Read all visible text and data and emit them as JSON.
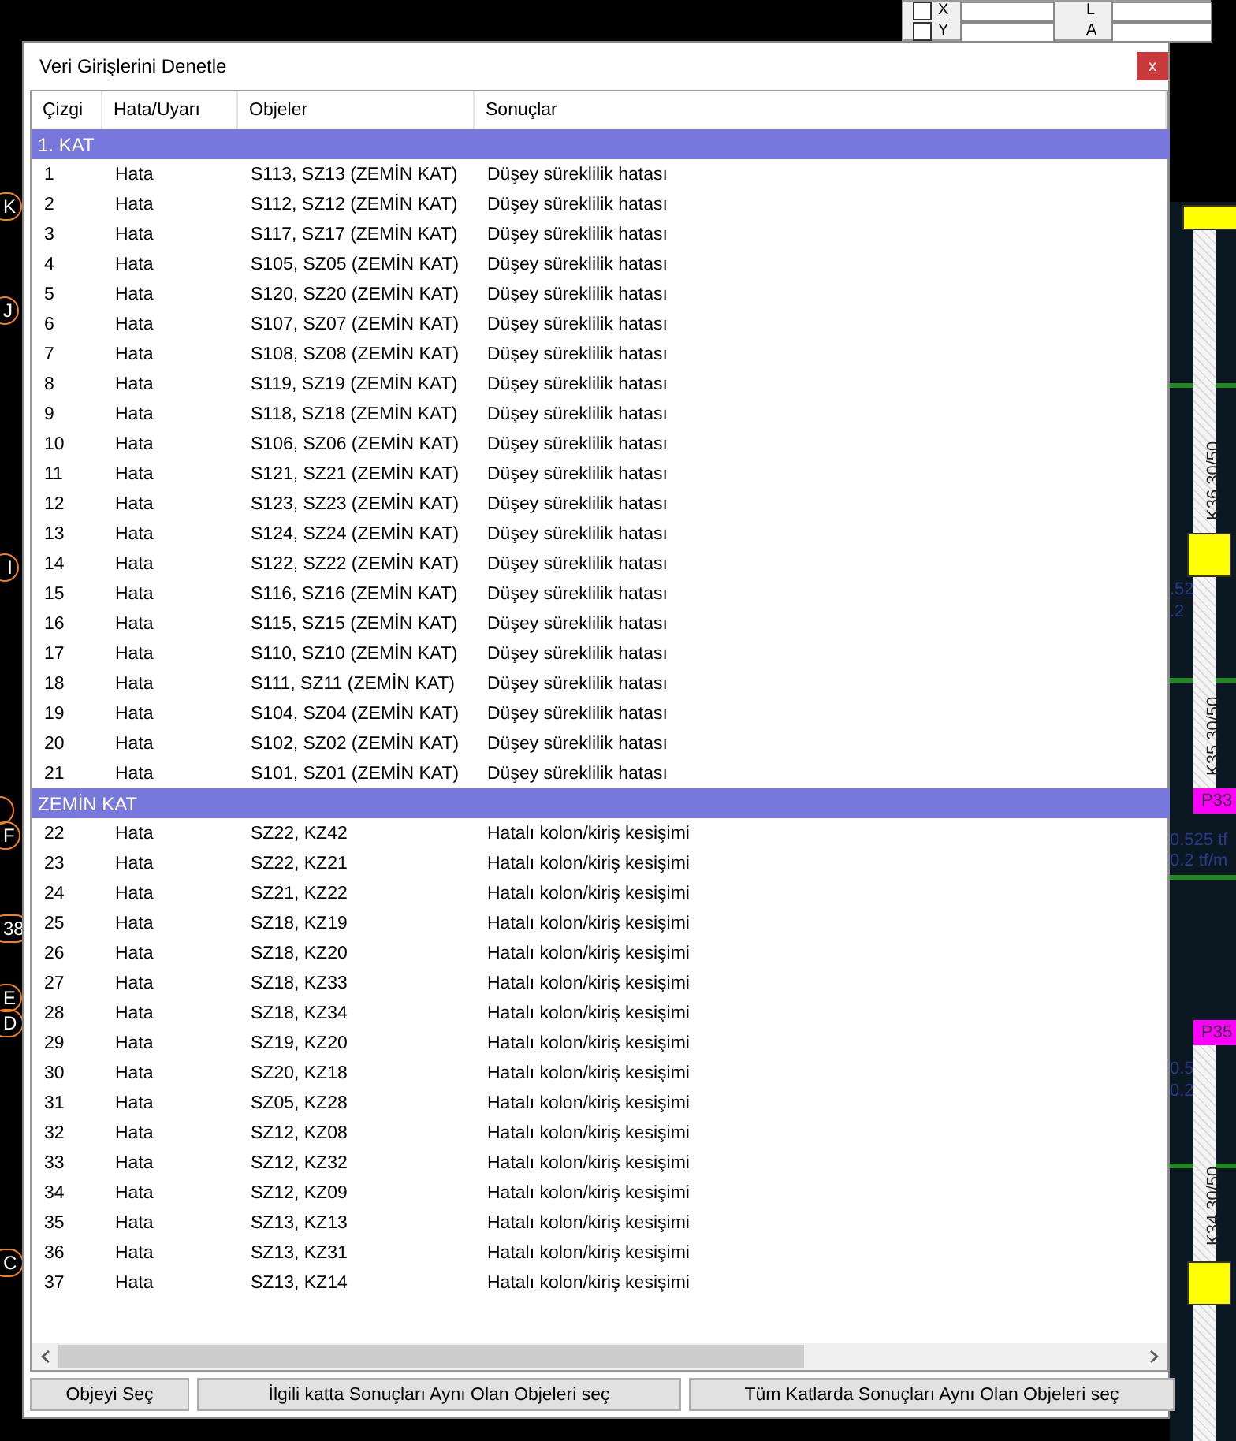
{
  "cad_panel": {
    "checks": [
      {
        "label": "X",
        "checked": false
      },
      {
        "label": "Y",
        "checked": false
      }
    ],
    "field_labels": [
      "L",
      "A"
    ]
  },
  "cad_axes": [
    {
      "label": "K"
    },
    {
      "label": "J"
    },
    {
      "label": "I"
    },
    {
      "label": "F"
    },
    {
      "label": "38"
    },
    {
      "label": "E"
    },
    {
      "label": "D"
    },
    {
      "label": "C"
    }
  ],
  "cad_beams": [
    "K36 30/50",
    "K35 30/50",
    "K34 30/50"
  ],
  "cad_columns": [
    "P33",
    "P35"
  ],
  "cad_loads": [
    ".52",
    ".2",
    "0.525 tf",
    "0.2 tf/m",
    "0.5",
    "0.2"
  ],
  "window": {
    "title": "Veri Girişlerini Denetle",
    "close": "x"
  },
  "table": {
    "columns": [
      "Çizgi",
      "Hata/Uyarı",
      "Objeler",
      "Sonuçlar"
    ],
    "groups": [
      {
        "title": "1. KAT",
        "rows": [
          {
            "line": "1",
            "type": "Hata",
            "objects": "S113, SZ13 (ZEMİN KAT)",
            "result": "Düşey süreklilik hatası"
          },
          {
            "line": "2",
            "type": "Hata",
            "objects": "S112, SZ12 (ZEMİN KAT)",
            "result": "Düşey süreklilik hatası"
          },
          {
            "line": "3",
            "type": "Hata",
            "objects": "S117, SZ17 (ZEMİN KAT)",
            "result": "Düşey süreklilik hatası"
          },
          {
            "line": "4",
            "type": "Hata",
            "objects": "S105, SZ05 (ZEMİN KAT)",
            "result": "Düşey süreklilik hatası"
          },
          {
            "line": "5",
            "type": "Hata",
            "objects": "S120, SZ20 (ZEMİN KAT)",
            "result": "Düşey süreklilik hatası"
          },
          {
            "line": "6",
            "type": "Hata",
            "objects": "S107, SZ07 (ZEMİN KAT)",
            "result": "Düşey süreklilik hatası"
          },
          {
            "line": "7",
            "type": "Hata",
            "objects": "S108, SZ08 (ZEMİN KAT)",
            "result": "Düşey süreklilik hatası"
          },
          {
            "line": "8",
            "type": "Hata",
            "objects": "S119, SZ19 (ZEMİN KAT)",
            "result": "Düşey süreklilik hatası"
          },
          {
            "line": "9",
            "type": "Hata",
            "objects": "S118, SZ18 (ZEMİN KAT)",
            "result": "Düşey süreklilik hatası"
          },
          {
            "line": "10",
            "type": "Hata",
            "objects": "S106, SZ06 (ZEMİN KAT)",
            "result": "Düşey süreklilik hatası"
          },
          {
            "line": "11",
            "type": "Hata",
            "objects": "S121, SZ21 (ZEMİN KAT)",
            "result": "Düşey süreklilik hatası"
          },
          {
            "line": "12",
            "type": "Hata",
            "objects": "S123, SZ23 (ZEMİN KAT)",
            "result": "Düşey süreklilik hatası"
          },
          {
            "line": "13",
            "type": "Hata",
            "objects": "S124, SZ24 (ZEMİN KAT)",
            "result": "Düşey süreklilik hatası"
          },
          {
            "line": "14",
            "type": "Hata",
            "objects": "S122, SZ22 (ZEMİN KAT)",
            "result": "Düşey süreklilik hatası"
          },
          {
            "line": "15",
            "type": "Hata",
            "objects": "S116, SZ16 (ZEMİN KAT)",
            "result": "Düşey süreklilik hatası"
          },
          {
            "line": "16",
            "type": "Hata",
            "objects": "S115, SZ15 (ZEMİN KAT)",
            "result": "Düşey süreklilik hatası"
          },
          {
            "line": "17",
            "type": "Hata",
            "objects": "S110, SZ10 (ZEMİN KAT)",
            "result": "Düşey süreklilik hatası"
          },
          {
            "line": "18",
            "type": "Hata",
            "objects": "S111, SZ11 (ZEMİN KAT)",
            "result": "Düşey süreklilik hatası"
          },
          {
            "line": "19",
            "type": "Hata",
            "objects": "S104, SZ04 (ZEMİN KAT)",
            "result": "Düşey süreklilik hatası"
          },
          {
            "line": "20",
            "type": "Hata",
            "objects": "S102, SZ02 (ZEMİN KAT)",
            "result": "Düşey süreklilik hatası"
          },
          {
            "line": "21",
            "type": "Hata",
            "objects": "S101, SZ01 (ZEMİN KAT)",
            "result": "Düşey süreklilik hatası"
          }
        ]
      },
      {
        "title": "ZEMİN KAT",
        "rows": [
          {
            "line": "22",
            "type": "Hata",
            "objects": "SZ22, KZ42",
            "result": "Hatalı kolon/kiriş kesişimi"
          },
          {
            "line": "23",
            "type": "Hata",
            "objects": "SZ22, KZ21",
            "result": "Hatalı kolon/kiriş kesişimi"
          },
          {
            "line": "24",
            "type": "Hata",
            "objects": "SZ21, KZ22",
            "result": "Hatalı kolon/kiriş kesişimi"
          },
          {
            "line": "25",
            "type": "Hata",
            "objects": "SZ18, KZ19",
            "result": "Hatalı kolon/kiriş kesişimi"
          },
          {
            "line": "26",
            "type": "Hata",
            "objects": "SZ18, KZ20",
            "result": "Hatalı kolon/kiriş kesişimi"
          },
          {
            "line": "27",
            "type": "Hata",
            "objects": "SZ18, KZ33",
            "result": "Hatalı kolon/kiriş kesişimi"
          },
          {
            "line": "28",
            "type": "Hata",
            "objects": "SZ18, KZ34",
            "result": "Hatalı kolon/kiriş kesişimi"
          },
          {
            "line": "29",
            "type": "Hata",
            "objects": "SZ19, KZ20",
            "result": "Hatalı kolon/kiriş kesişimi"
          },
          {
            "line": "30",
            "type": "Hata",
            "objects": "SZ20, KZ18",
            "result": "Hatalı kolon/kiriş kesişimi"
          },
          {
            "line": "31",
            "type": "Hata",
            "objects": "SZ05, KZ28",
            "result": "Hatalı kolon/kiriş kesişimi"
          },
          {
            "line": "32",
            "type": "Hata",
            "objects": "SZ12, KZ08",
            "result": "Hatalı kolon/kiriş kesişimi"
          },
          {
            "line": "33",
            "type": "Hata",
            "objects": "SZ12, KZ32",
            "result": "Hatalı kolon/kiriş kesişimi"
          },
          {
            "line": "34",
            "type": "Hata",
            "objects": "SZ12, KZ09",
            "result": "Hatalı kolon/kiriş kesişimi"
          },
          {
            "line": "35",
            "type": "Hata",
            "objects": "SZ13, KZ13",
            "result": "Hatalı kolon/kiriş kesişimi"
          },
          {
            "line": "36",
            "type": "Hata",
            "objects": "SZ13, KZ31",
            "result": "Hatalı kolon/kiriş kesişimi"
          },
          {
            "line": "37",
            "type": "Hata",
            "objects": "SZ13, KZ14",
            "result": "Hatalı kolon/kiriş kesişimi"
          }
        ]
      }
    ]
  },
  "buttons": [
    "Objeyi Seç",
    "İlgili katta Sonuçları Aynı Olan Objeleri seç",
    "Tüm Katlarda Sonuçları Aynı Olan Objeleri seç"
  ]
}
